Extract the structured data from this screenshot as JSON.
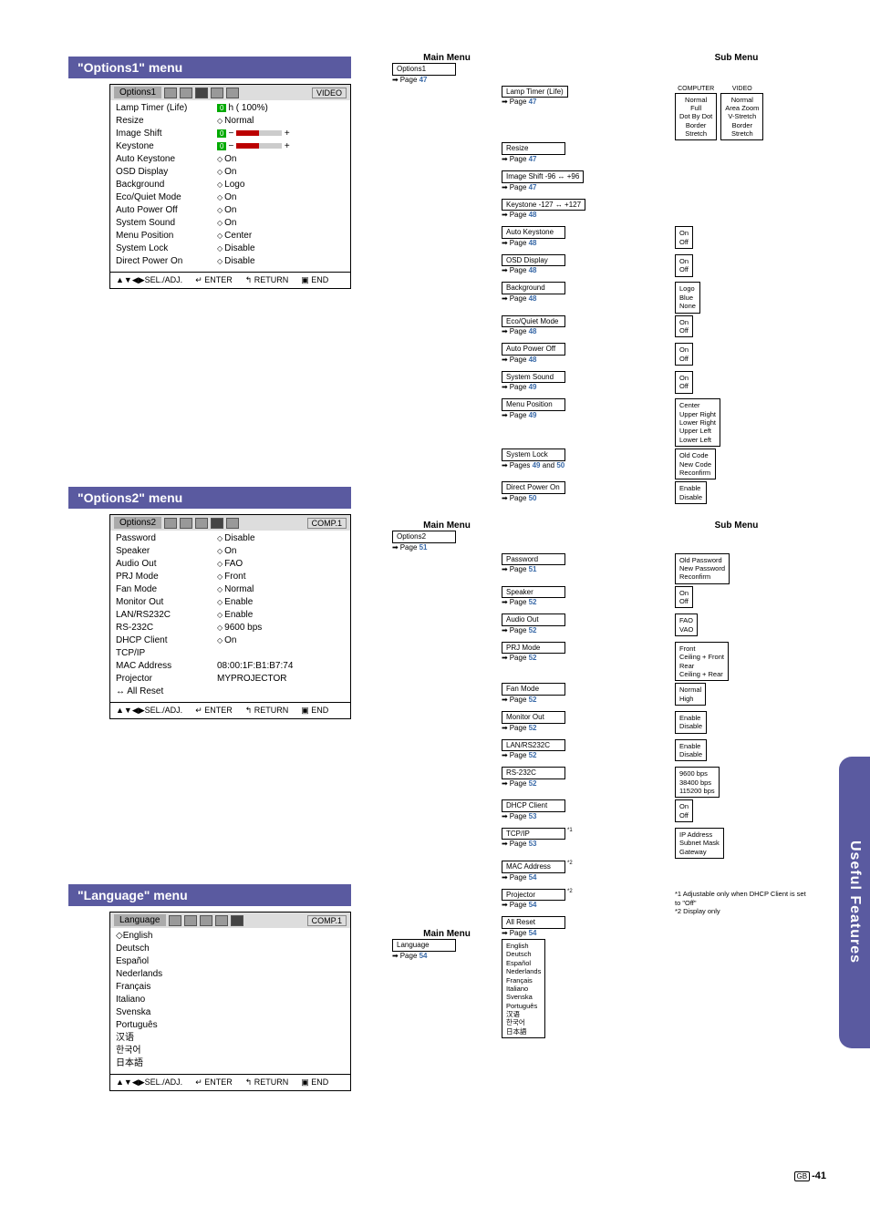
{
  "sections": {
    "options1_title": "\"Options1\" menu",
    "options2_title": "\"Options2\" menu",
    "language_title": "\"Language\" menu"
  },
  "osd1": {
    "title": "Options1",
    "input": "VIDEO",
    "rows": [
      {
        "label": "Lamp Timer (Life)",
        "value_pre": "0",
        "value": "h ( 100%)"
      },
      {
        "label": "Resize",
        "value": "Normal",
        "diamond": true
      },
      {
        "label": "Image Shift",
        "value_pre": "0",
        "slider": true
      },
      {
        "label": "Keystone",
        "value_pre": "0",
        "slider": true
      },
      {
        "label": "Auto Keystone",
        "value": "On",
        "diamond": true
      },
      {
        "label": "OSD Display",
        "value": "On",
        "diamond": true
      },
      {
        "label": "Background",
        "value": "Logo",
        "diamond": true
      },
      {
        "label": "Eco/Quiet Mode",
        "value": "On",
        "diamond": true
      },
      {
        "label": "Auto Power Off",
        "value": "On",
        "diamond": true
      },
      {
        "label": "System Sound",
        "value": "On",
        "diamond": true
      },
      {
        "label": "Menu Position",
        "value": "Center",
        "diamond": true
      },
      {
        "label": "System Lock",
        "value": "Disable",
        "diamond": true
      },
      {
        "label": "Direct Power On",
        "value": "Disable",
        "diamond": true
      }
    ],
    "footer": {
      "sel": "▲▼◀▶SEL./ADJ.",
      "enter": "↵ ENTER",
      "return": "↰ RETURN",
      "end": "▣ END"
    }
  },
  "osd2": {
    "title": "Options2",
    "input": "COMP.1",
    "rows": [
      {
        "label": "Password",
        "value": "Disable",
        "diamond": true
      },
      {
        "label": "Speaker",
        "value": "On",
        "diamond": true
      },
      {
        "label": "Audio Out",
        "value": "FAO",
        "diamond": true
      },
      {
        "label": "PRJ Mode",
        "value": "Front",
        "diamond": true
      },
      {
        "label": "Fan Mode",
        "value": "Normal",
        "diamond": true
      },
      {
        "label": "Monitor Out",
        "value": "Enable",
        "diamond": true
      },
      {
        "label": "LAN/RS232C",
        "value": "Enable",
        "diamond": true
      },
      {
        "label": "RS-232C",
        "value": "9600 bps",
        "diamond": true
      },
      {
        "label": "DHCP Client",
        "value": "On",
        "diamond": true
      },
      {
        "label": "TCP/IP",
        "value": ""
      },
      {
        "label": "MAC Address",
        "value": "08:00:1F:B1:B7:74"
      },
      {
        "label": "Projector",
        "value": "MYPROJECTOR"
      },
      {
        "label": "↔ All Reset",
        "value": ""
      }
    ],
    "footer": {
      "sel": "▲▼◀▶SEL./ADJ.",
      "enter": "↵ ENTER",
      "return": "↰ RETURN",
      "end": "▣ END"
    }
  },
  "osd3": {
    "title": "Language",
    "input": "COMP.1",
    "rows": [
      {
        "label": "English",
        "diamond_left": true
      },
      {
        "label": "Deutsch"
      },
      {
        "label": "Español"
      },
      {
        "label": "Nederlands"
      },
      {
        "label": "Français"
      },
      {
        "label": "Italiano"
      },
      {
        "label": "Svenska"
      },
      {
        "label": "Português"
      },
      {
        "label": "汉语"
      },
      {
        "label": "한국어"
      },
      {
        "label": "日本語"
      }
    ],
    "footer": {
      "sel": "▲▼◀▶SEL./ADJ.",
      "enter": "↵ ENTER",
      "return": "↰ RETURN",
      "end": "▣ END"
    }
  },
  "tree_labels": {
    "main_menu": "Main Menu",
    "sub_menu": "Sub Menu"
  },
  "tree1": {
    "main": {
      "label": "Options1",
      "page": "47"
    },
    "items": [
      {
        "label": "Lamp Timer (Life)",
        "page": "47",
        "sub_cols": [
          {
            "head": "COMPUTER",
            "opts": [
              "Normal",
              "Full",
              "Dot By Dot",
              "Border",
              "Stretch"
            ]
          },
          {
            "head": "VIDEO",
            "opts": [
              "Normal",
              "Area Zoom",
              "V-Stretch",
              "Border",
              "Stretch"
            ]
          }
        ],
        "sub_for_next": true
      },
      {
        "label": "Resize",
        "page": "47"
      },
      {
        "label": "Image Shift   -96 ↔ +96",
        "page": "47"
      },
      {
        "label": "Keystone   -127 ↔ +127",
        "page": "48"
      },
      {
        "label": "Auto Keystone",
        "page": "48",
        "sub": [
          "On",
          "Off"
        ]
      },
      {
        "label": "OSD Display",
        "page": "48",
        "sub": [
          "On",
          "Off"
        ]
      },
      {
        "label": "Background",
        "page": "48",
        "sub": [
          "Logo",
          "Blue",
          "None"
        ]
      },
      {
        "label": "Eco/Quiet Mode",
        "page": "48",
        "sub": [
          "On",
          "Off"
        ]
      },
      {
        "label": "Auto Power Off",
        "page": "48",
        "sub": [
          "On",
          "Off"
        ]
      },
      {
        "label": "System Sound",
        "page": "49",
        "sub": [
          "On",
          "Off"
        ]
      },
      {
        "label": "Menu Position",
        "page": "49",
        "sub": [
          "Center",
          "Upper Right",
          "Lower Right",
          "Upper Left",
          "Lower Left"
        ]
      },
      {
        "label": "System Lock",
        "page_text": "Pages 49 and 50",
        "pages": [
          "49",
          "50"
        ],
        "sub": [
          "Old Code",
          "New Code",
          "Reconfirm"
        ]
      },
      {
        "label": "Direct Power On",
        "page": "50",
        "sub": [
          "Enable",
          "Disable"
        ]
      }
    ]
  },
  "tree2": {
    "main": {
      "label": "Options2",
      "page": "51"
    },
    "items": [
      {
        "label": "Password",
        "page": "51",
        "sub": [
          "Old Password",
          "New Password",
          "Reconfirm"
        ]
      },
      {
        "label": "Speaker",
        "page": "52",
        "sub": [
          "On",
          "Off"
        ]
      },
      {
        "label": "Audio Out",
        "page": "52",
        "sub": [
          "FAO",
          "VAO"
        ]
      },
      {
        "label": "PRJ Mode",
        "page": "52",
        "sub": [
          "Front",
          "Ceiling + Front",
          "Rear",
          "Ceiling + Rear"
        ]
      },
      {
        "label": "Fan Mode",
        "page": "52",
        "sub": [
          "Normal",
          "High"
        ]
      },
      {
        "label": "Monitor Out",
        "page": "52",
        "sub": [
          "Enable",
          "Disable"
        ]
      },
      {
        "label": "LAN/RS232C",
        "page": "52",
        "sub": [
          "Enable",
          "Disable"
        ]
      },
      {
        "label": "RS-232C",
        "page": "52",
        "sub": [
          "9600 bps",
          "38400 bps",
          "115200 bps"
        ]
      },
      {
        "label": "DHCP Client",
        "page": "53",
        "sub": [
          "On",
          "Off"
        ]
      },
      {
        "label": "TCP/IP",
        "page": "53",
        "note": "*1",
        "sub": [
          "IP Address",
          "Subnet Mask",
          "Gateway"
        ]
      },
      {
        "label": "MAC Address",
        "page": "54",
        "note": "*2"
      },
      {
        "label": "Projector",
        "page": "54",
        "note": "*2"
      },
      {
        "label": "All Reset",
        "page": "54"
      }
    ],
    "notes": [
      "*1 Adjustable only when DHCP Client is set to \"Off\"",
      "*2 Display only"
    ]
  },
  "tree3": {
    "main": {
      "label": "Language",
      "page": "54"
    },
    "items": [
      "English",
      "Deutsch",
      "Español",
      "Nederlands",
      "Français",
      "Italiano",
      "Svenska",
      "Português",
      "汉语",
      "한국어",
      "日本語"
    ]
  },
  "side_tab": "Useful Features",
  "page_footer": {
    "region": "GB",
    "num": "-41"
  }
}
